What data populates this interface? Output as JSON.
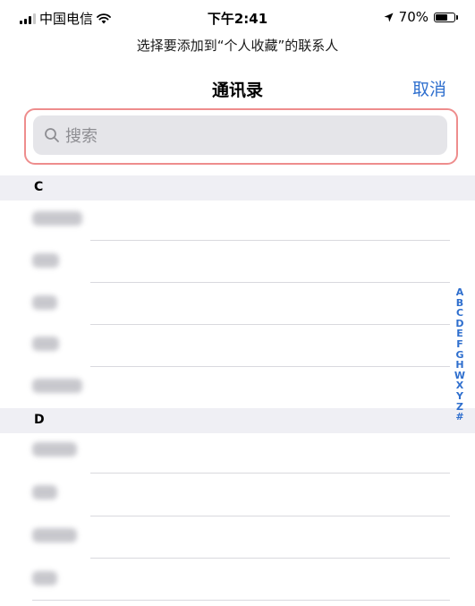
{
  "status_bar": {
    "carrier": "中国电信",
    "time": "下午2:41",
    "battery": "70%",
    "battery_level": 0.7
  },
  "header": {
    "prompt": "选择要添加到“个人收藏”的联系人",
    "title": "通讯录",
    "cancel_label": "取消"
  },
  "search": {
    "placeholder": "搜索"
  },
  "sections": [
    {
      "letter": "C"
    },
    {
      "letter": "D"
    }
  ],
  "index_letters": [
    "A",
    "B",
    "C",
    "D",
    "E",
    "F",
    "G",
    "H",
    "W",
    "X",
    "Y",
    "Z",
    "#"
  ],
  "colors": {
    "accent": "#2f6fce",
    "highlight": "#ee8d8d",
    "section_bg": "#efeff4",
    "search_bg": "#e5e5e9"
  }
}
